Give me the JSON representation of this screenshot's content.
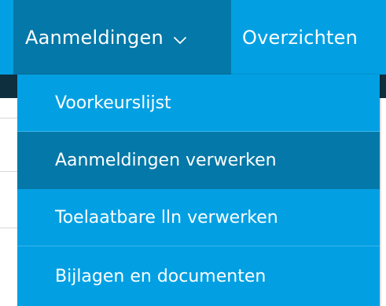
{
  "nav": {
    "active_label": "Aanmeldingen",
    "active_icon": "chevron-down-icon",
    "other_label": "Overzichten"
  },
  "dropdown": {
    "items": [
      {
        "label": "Voorkeurslijst",
        "highlighted": false
      },
      {
        "label": "Aanmeldingen verwerken",
        "highlighted": true
      },
      {
        "label": "Toelaatbare lln verwerken",
        "highlighted": false
      },
      {
        "label": "Bijlagen en documenten",
        "highlighted": false
      }
    ]
  },
  "colors": {
    "menu_blue": "#02a0e3",
    "active_blue": "#0478a8",
    "text": "#ffffff"
  }
}
